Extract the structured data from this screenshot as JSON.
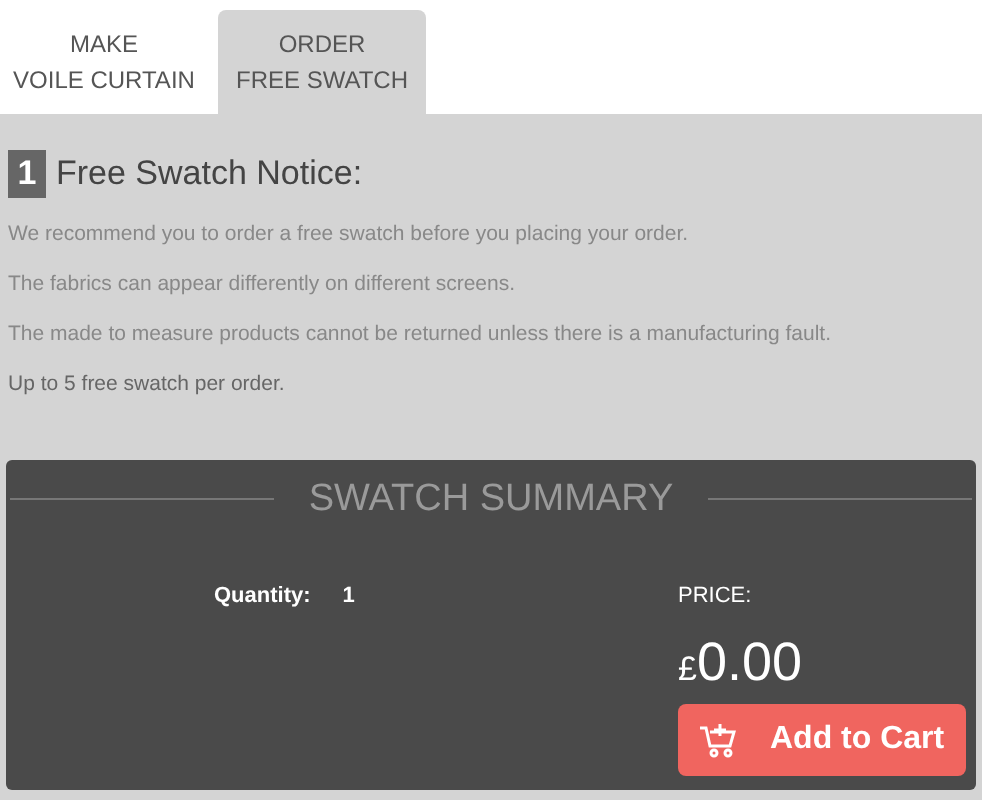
{
  "tabs": [
    {
      "lines": [
        "MAKE",
        "VOILE CURTAIN"
      ],
      "selected": false
    },
    {
      "lines": [
        "ORDER",
        "FREE SWATCH"
      ],
      "selected": true
    }
  ],
  "notice": {
    "step": "1",
    "title": "Free Swatch Notice:",
    "paragraphs": [
      "We recommend you to order a free swatch before you placing your order.",
      "The fabrics can appear differently on different screens.",
      "The made to measure products cannot be returned unless there is a manufacturing fault.",
      "Up to 5 free swatch per order."
    ]
  },
  "summary": {
    "title": "SWATCH SUMMARY",
    "quantity_label": "Quantity:",
    "quantity": "1",
    "price_label": "PRICE:",
    "currency": "£",
    "price": "0.00",
    "button": "Add to Cart"
  }
}
